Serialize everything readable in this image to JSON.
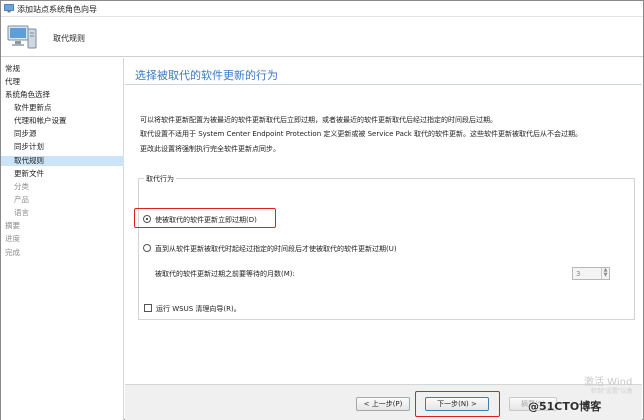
{
  "window": {
    "title": "添加站点系统角色向导"
  },
  "header": {
    "title": "取代规则"
  },
  "nav": {
    "items": [
      {
        "label": "常规",
        "level": "top",
        "state": "normal"
      },
      {
        "label": "代理",
        "level": "top",
        "state": "normal"
      },
      {
        "label": "系统角色选择",
        "level": "top",
        "state": "normal"
      },
      {
        "label": "软件更新点",
        "level": "sub",
        "state": "normal"
      },
      {
        "label": "代理和帐户设置",
        "level": "sub",
        "state": "normal"
      },
      {
        "label": "同步源",
        "level": "sub",
        "state": "normal"
      },
      {
        "label": "同步计划",
        "level": "sub",
        "state": "normal"
      },
      {
        "label": "取代规则",
        "level": "sub",
        "state": "selected"
      },
      {
        "label": "更新文件",
        "level": "sub",
        "state": "normal"
      },
      {
        "label": "分类",
        "level": "sub",
        "state": "dim"
      },
      {
        "label": "产品",
        "level": "sub",
        "state": "dim"
      },
      {
        "label": "语言",
        "level": "sub",
        "state": "dim"
      },
      {
        "label": "摘要",
        "level": "top",
        "state": "dim"
      },
      {
        "label": "进度",
        "level": "top",
        "state": "dim"
      },
      {
        "label": "完成",
        "level": "top",
        "state": "dim"
      }
    ]
  },
  "main": {
    "title": "选择被取代的软件更新的行为",
    "description": [
      "可以将软件更新配置为被最近的软件更新取代后立即过期，或者被最近的软件更新取代后经过指定的时间段后过期。",
      "取代设置不适用于 System Center Endpoint Protection 定义更新或被 Service Pack 取代的软件更新。这些软件更新被取代后从不会过期。",
      "更改此设置将强制执行完全软件更新点同步。"
    ],
    "group_label": "取代行为",
    "option_immediate": "使被取代的软件更新立即过期(D)",
    "option_delayed": "直到从软件更新被取代时起经过指定的时间段后才使被取代的软件更新过期(U)",
    "months_label": "被取代的软件更新过期之前要等待的月数(M):",
    "months_value": "3",
    "wsus_cleanup_label": "运行 WSUS 清理向导(R)。"
  },
  "footer": {
    "prev_label": "< 上一步(P)",
    "next_label": "下一步(N) >",
    "summary_label": "摘要(S)"
  },
  "watermark": {
    "line1": "激活 Wind",
    "line2": "转到\"设置\"以激",
    "site": "@51CTO博客"
  },
  "colors": {
    "accent_title": "#3b78c3",
    "selected_nav": "#cde3f7",
    "highlight_box": "#e02020"
  },
  "icons": {
    "title_icon": "computer-icon",
    "header_icon": "server-computer-icon"
  }
}
